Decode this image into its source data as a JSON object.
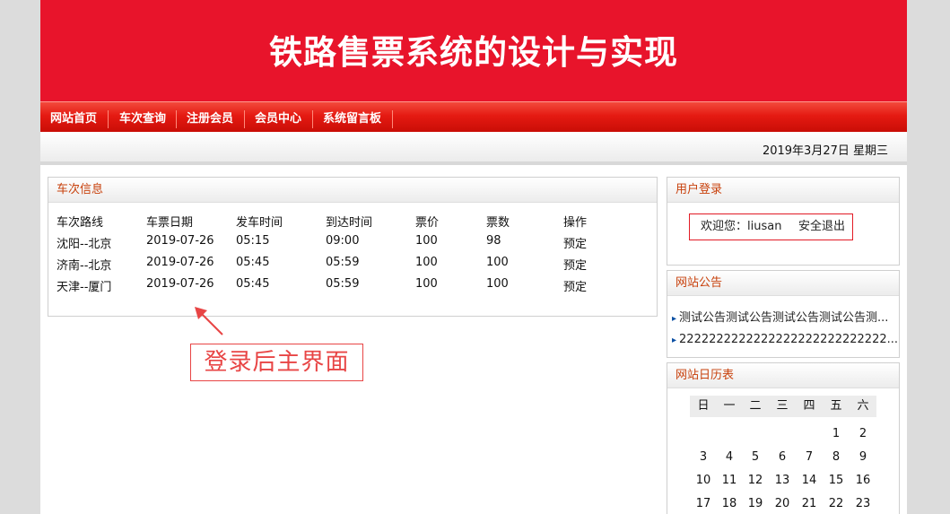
{
  "banner": {
    "title": "铁路售票系统的设计与实现"
  },
  "nav": [
    "网站首页",
    "车次查询",
    "注册会员",
    "会员中心",
    "系统留言板"
  ],
  "date": "2019年3月27日 星期三",
  "train_panel": {
    "title": "车次信息",
    "columns": [
      "车次路线",
      "车票日期",
      "发车时间",
      "到达时间",
      "票价",
      "票数",
      "操作"
    ],
    "rows": [
      [
        "沈阳--北京",
        "2019-07-26",
        "05:15",
        "09:00",
        "100",
        "98",
        "预定"
      ],
      [
        "济南--北京",
        "2019-07-26",
        "05:45",
        "05:59",
        "100",
        "100",
        "预定"
      ],
      [
        "天津--厦门",
        "2019-07-26",
        "05:45",
        "05:59",
        "100",
        "100",
        "预定"
      ]
    ]
  },
  "annotation": "登录后主界面",
  "login_panel": {
    "title": "用户登录",
    "welcome": "欢迎您：liusan",
    "logout": "安全退出"
  },
  "notice_panel": {
    "title": "网站公告",
    "items": [
      "测试公告测试公告测试公告测试公告测...",
      "2222222222222222222222222222..."
    ]
  },
  "calendar_panel": {
    "title": "网站日历表",
    "weekdays": [
      "日",
      "一",
      "二",
      "三",
      "四",
      "五",
      "六"
    ],
    "weeks": [
      [
        "",
        "",
        "",
        "",
        "",
        "1",
        "2"
      ],
      [
        "3",
        "4",
        "5",
        "6",
        "7",
        "8",
        "9"
      ],
      [
        "10",
        "11",
        "12",
        "13",
        "14",
        "15",
        "16"
      ],
      [
        "17",
        "18",
        "19",
        "20",
        "21",
        "22",
        "23"
      ]
    ]
  },
  "colors": {
    "brand_red": "#e8142b",
    "nav_red": "#e51a12",
    "panel_title": "#c8410c",
    "annotation": "#e84545"
  }
}
